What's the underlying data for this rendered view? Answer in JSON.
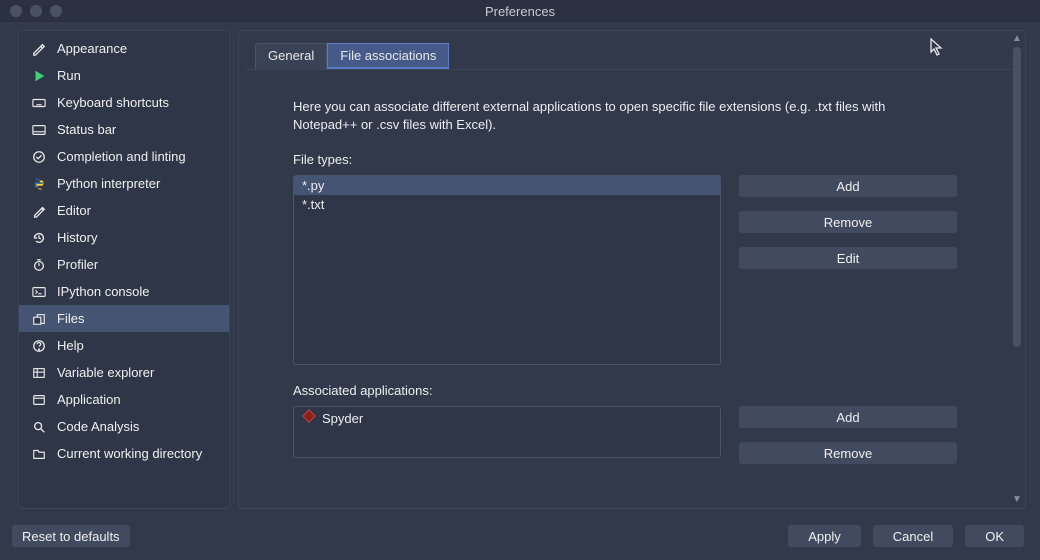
{
  "window": {
    "title": "Preferences"
  },
  "sidebar": [
    {
      "id": "appearance",
      "label": "Appearance"
    },
    {
      "id": "run",
      "label": "Run"
    },
    {
      "id": "keyboard-shortcuts",
      "label": "Keyboard shortcuts"
    },
    {
      "id": "status-bar",
      "label": "Status bar"
    },
    {
      "id": "completion-linting",
      "label": "Completion and linting"
    },
    {
      "id": "python-interpreter",
      "label": "Python interpreter"
    },
    {
      "id": "editor",
      "label": "Editor"
    },
    {
      "id": "history",
      "label": "History"
    },
    {
      "id": "profiler",
      "label": "Profiler"
    },
    {
      "id": "ipython-console",
      "label": "IPython console"
    },
    {
      "id": "files",
      "label": "Files"
    },
    {
      "id": "help",
      "label": "Help"
    },
    {
      "id": "variable-explorer",
      "label": "Variable explorer"
    },
    {
      "id": "application",
      "label": "Application"
    },
    {
      "id": "code-analysis",
      "label": "Code Analysis"
    },
    {
      "id": "cwd",
      "label": "Current working directory"
    }
  ],
  "sidebar_selected": "files",
  "tabs": [
    {
      "id": "general",
      "label": "General"
    },
    {
      "id": "file-associations",
      "label": "File associations"
    }
  ],
  "tabs_selected": "file-associations",
  "description": "Here you can associate different external applications to open specific file extensions (e.g. .txt files with Notepad++ or .csv files with Excel).",
  "file_types_label": "File types:",
  "file_types": [
    "*.py",
    "*.txt"
  ],
  "file_types_selected_index": 0,
  "file_types_buttons": {
    "add": "Add",
    "remove": "Remove",
    "edit": "Edit"
  },
  "associated_label": "Associated applications:",
  "associated_apps": [
    "Spyder"
  ],
  "associated_buttons": {
    "add": "Add",
    "remove": "Remove"
  },
  "footer": {
    "reset": "Reset to defaults",
    "apply": "Apply",
    "cancel": "Cancel",
    "ok": "OK"
  },
  "colors": {
    "accent": "#5b7bc4",
    "panel": "#32394b",
    "listbg": "#2f3648",
    "button": "#424a60"
  }
}
